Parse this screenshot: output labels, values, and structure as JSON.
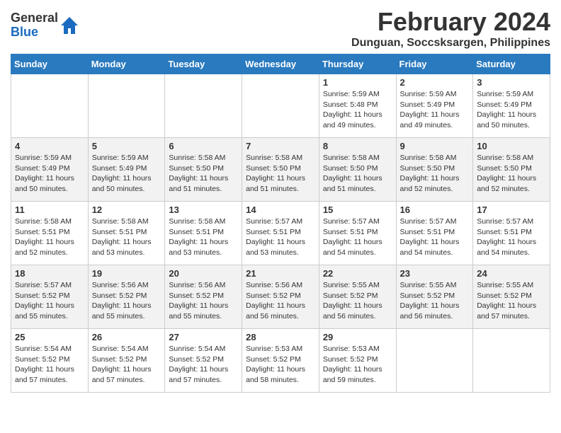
{
  "logo": {
    "general": "General",
    "blue": "Blue"
  },
  "title": "February 2024",
  "subtitle": "Dunguan, Soccsksargen, Philippines",
  "days_of_week": [
    "Sunday",
    "Monday",
    "Tuesday",
    "Wednesday",
    "Thursday",
    "Friday",
    "Saturday"
  ],
  "weeks": [
    [
      {
        "day": "",
        "info": ""
      },
      {
        "day": "",
        "info": ""
      },
      {
        "day": "",
        "info": ""
      },
      {
        "day": "",
        "info": ""
      },
      {
        "day": "1",
        "info": "Sunrise: 5:59 AM\nSunset: 5:48 PM\nDaylight: 11 hours and 49 minutes."
      },
      {
        "day": "2",
        "info": "Sunrise: 5:59 AM\nSunset: 5:49 PM\nDaylight: 11 hours and 49 minutes."
      },
      {
        "day": "3",
        "info": "Sunrise: 5:59 AM\nSunset: 5:49 PM\nDaylight: 11 hours and 50 minutes."
      }
    ],
    [
      {
        "day": "4",
        "info": "Sunrise: 5:59 AM\nSunset: 5:49 PM\nDaylight: 11 hours and 50 minutes."
      },
      {
        "day": "5",
        "info": "Sunrise: 5:59 AM\nSunset: 5:49 PM\nDaylight: 11 hours and 50 minutes."
      },
      {
        "day": "6",
        "info": "Sunrise: 5:58 AM\nSunset: 5:50 PM\nDaylight: 11 hours and 51 minutes."
      },
      {
        "day": "7",
        "info": "Sunrise: 5:58 AM\nSunset: 5:50 PM\nDaylight: 11 hours and 51 minutes."
      },
      {
        "day": "8",
        "info": "Sunrise: 5:58 AM\nSunset: 5:50 PM\nDaylight: 11 hours and 51 minutes."
      },
      {
        "day": "9",
        "info": "Sunrise: 5:58 AM\nSunset: 5:50 PM\nDaylight: 11 hours and 52 minutes."
      },
      {
        "day": "10",
        "info": "Sunrise: 5:58 AM\nSunset: 5:50 PM\nDaylight: 11 hours and 52 minutes."
      }
    ],
    [
      {
        "day": "11",
        "info": "Sunrise: 5:58 AM\nSunset: 5:51 PM\nDaylight: 11 hours and 52 minutes."
      },
      {
        "day": "12",
        "info": "Sunrise: 5:58 AM\nSunset: 5:51 PM\nDaylight: 11 hours and 53 minutes."
      },
      {
        "day": "13",
        "info": "Sunrise: 5:58 AM\nSunset: 5:51 PM\nDaylight: 11 hours and 53 minutes."
      },
      {
        "day": "14",
        "info": "Sunrise: 5:57 AM\nSunset: 5:51 PM\nDaylight: 11 hours and 53 minutes."
      },
      {
        "day": "15",
        "info": "Sunrise: 5:57 AM\nSunset: 5:51 PM\nDaylight: 11 hours and 54 minutes."
      },
      {
        "day": "16",
        "info": "Sunrise: 5:57 AM\nSunset: 5:51 PM\nDaylight: 11 hours and 54 minutes."
      },
      {
        "day": "17",
        "info": "Sunrise: 5:57 AM\nSunset: 5:51 PM\nDaylight: 11 hours and 54 minutes."
      }
    ],
    [
      {
        "day": "18",
        "info": "Sunrise: 5:57 AM\nSunset: 5:52 PM\nDaylight: 11 hours and 55 minutes."
      },
      {
        "day": "19",
        "info": "Sunrise: 5:56 AM\nSunset: 5:52 PM\nDaylight: 11 hours and 55 minutes."
      },
      {
        "day": "20",
        "info": "Sunrise: 5:56 AM\nSunset: 5:52 PM\nDaylight: 11 hours and 55 minutes."
      },
      {
        "day": "21",
        "info": "Sunrise: 5:56 AM\nSunset: 5:52 PM\nDaylight: 11 hours and 56 minutes."
      },
      {
        "day": "22",
        "info": "Sunrise: 5:55 AM\nSunset: 5:52 PM\nDaylight: 11 hours and 56 minutes."
      },
      {
        "day": "23",
        "info": "Sunrise: 5:55 AM\nSunset: 5:52 PM\nDaylight: 11 hours and 56 minutes."
      },
      {
        "day": "24",
        "info": "Sunrise: 5:55 AM\nSunset: 5:52 PM\nDaylight: 11 hours and 57 minutes."
      }
    ],
    [
      {
        "day": "25",
        "info": "Sunrise: 5:54 AM\nSunset: 5:52 PM\nDaylight: 11 hours and 57 minutes."
      },
      {
        "day": "26",
        "info": "Sunrise: 5:54 AM\nSunset: 5:52 PM\nDaylight: 11 hours and 57 minutes."
      },
      {
        "day": "27",
        "info": "Sunrise: 5:54 AM\nSunset: 5:52 PM\nDaylight: 11 hours and 57 minutes."
      },
      {
        "day": "28",
        "info": "Sunrise: 5:53 AM\nSunset: 5:52 PM\nDaylight: 11 hours and 58 minutes."
      },
      {
        "day": "29",
        "info": "Sunrise: 5:53 AM\nSunset: 5:52 PM\nDaylight: 11 hours and 59 minutes."
      },
      {
        "day": "",
        "info": ""
      },
      {
        "day": "",
        "info": ""
      }
    ]
  ]
}
